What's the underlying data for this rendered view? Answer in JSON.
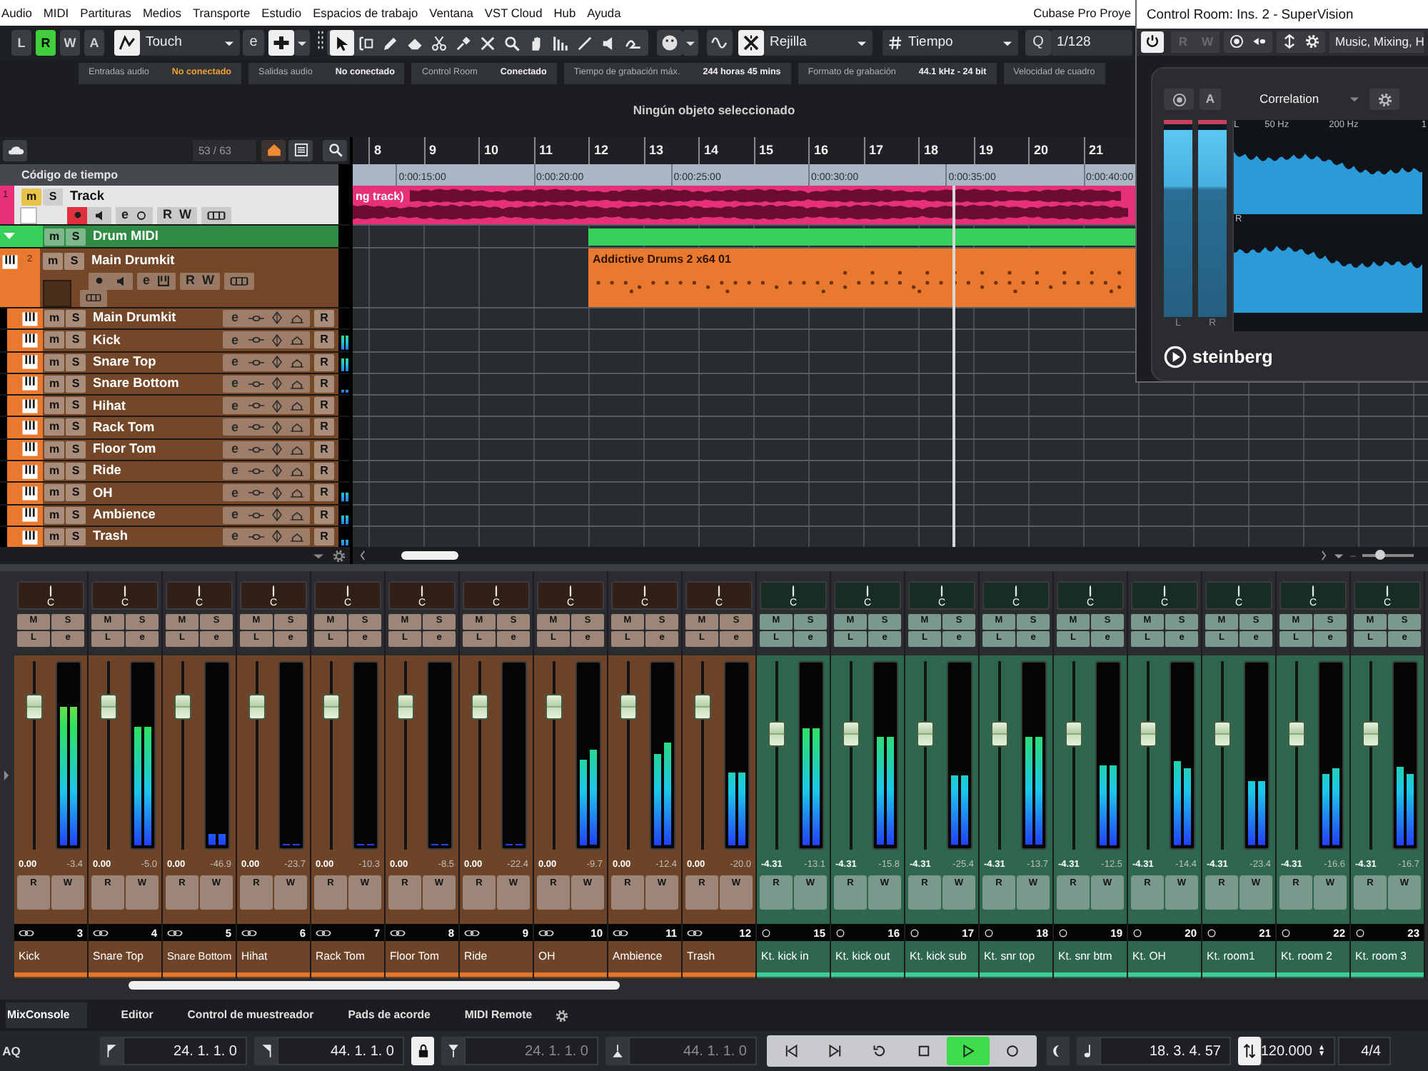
{
  "menu_bar": {
    "items": [
      "Audio",
      "MIDI",
      "Partituras",
      "Medios",
      "Transporte",
      "Estudio",
      "Espacios de trabajo",
      "Ventana",
      "VST Cloud",
      "Hub",
      "Ayuda"
    ],
    "app_title": "Cubase Pro Proye"
  },
  "toolbar": {
    "automation": [
      {
        "label": "L",
        "selected": false
      },
      {
        "label": "R",
        "selected": true
      },
      {
        "label": "W",
        "selected": false
      },
      {
        "label": "A",
        "selected": false
      }
    ],
    "automation_mode": "Touch",
    "edit_label": "e",
    "tools": [
      {
        "kind": "select",
        "selected": true
      },
      {
        "kind": "range",
        "selected": false
      },
      {
        "kind": "draw",
        "selected": false
      },
      {
        "kind": "erase",
        "selected": false
      },
      {
        "kind": "split",
        "selected": false
      },
      {
        "kind": "glue",
        "selected": false
      },
      {
        "kind": "mute",
        "selected": false
      },
      {
        "kind": "zoom",
        "selected": false
      },
      {
        "kind": "hand",
        "selected": false
      },
      {
        "kind": "comp",
        "selected": false
      },
      {
        "kind": "line",
        "selected": false
      },
      {
        "kind": "play",
        "selected": false
      },
      {
        "kind": "warp",
        "selected": false
      }
    ],
    "snap": "Rejilla",
    "grid_type": "Tiempo",
    "quantize_label": "Q",
    "quantize": "1/128"
  },
  "status_line": [
    {
      "label": "Entradas audio",
      "value": "No conectado",
      "warning": true
    },
    {
      "label": "Salidas audio",
      "value": "No conectado",
      "warning": false
    },
    {
      "label": "Control Room",
      "value": "Conectado",
      "warning": false
    },
    {
      "label": "Tiempo de grabación máx.",
      "value": "244 horas 45 mins",
      "warning": false
    },
    {
      "label": "Formato de grabación",
      "value": "44.1 kHz - 24 bit",
      "warning": false
    },
    {
      "label": "Velocidad de cuadro"
    }
  ],
  "info_line": "Ningún objeto seleccionado",
  "track_list": {
    "counter": "53 / 63",
    "ruler_track": "Código de tiempo",
    "tracks": [
      {
        "kind": "audio",
        "number": "1",
        "name": "Track",
        "color": "#e6307a",
        "selected": true,
        "muted": true,
        "armed": true,
        "buttons": [
          "m",
          "S"
        ],
        "controls": [
          "e",
          "R",
          "W"
        ]
      },
      {
        "kind": "folder",
        "name": "Drum MIDI",
        "color": "#36d05a",
        "selected": false,
        "muted": false,
        "buttons": [
          "m",
          "S"
        ]
      },
      {
        "kind": "instrument",
        "number": "2",
        "name": "Main Drumkit",
        "color": "#e8792e",
        "selected": false,
        "muted": false,
        "armed": false,
        "buttons": [
          "m",
          "S"
        ],
        "controls": [
          "e",
          "R",
          "W"
        ]
      },
      {
        "kind": "channel",
        "name": "Main Drumkit",
        "color": "#e8792e",
        "selected": false,
        "muted": false,
        "buttons": [
          "m",
          "S"
        ],
        "controls": [
          "e",
          "R"
        ]
      },
      {
        "kind": "channel",
        "name": "Kick",
        "color": "#e8792e",
        "selected": false,
        "muted": false,
        "buttons": [
          "m",
          "S"
        ],
        "controls": [
          "e",
          "R"
        ],
        "level": 0.8
      },
      {
        "kind": "channel",
        "name": "Snare Top",
        "color": "#e8792e",
        "selected": false,
        "muted": false,
        "buttons": [
          "m",
          "S"
        ],
        "controls": [
          "e",
          "R"
        ],
        "level": 0.75
      },
      {
        "kind": "channel",
        "name": "Snare Bottom",
        "color": "#e8792e",
        "selected": false,
        "muted": false,
        "buttons": [
          "m",
          "S"
        ],
        "controls": [
          "e",
          "R"
        ],
        "level": 0.15
      },
      {
        "kind": "channel",
        "name": "Hihat",
        "color": "#e8792e",
        "selected": false,
        "muted": false,
        "buttons": [
          "m",
          "S"
        ],
        "controls": [
          "e",
          "R"
        ]
      },
      {
        "kind": "channel",
        "name": "Rack Tom",
        "color": "#e8792e",
        "selected": false,
        "muted": false,
        "buttons": [
          "m",
          "S"
        ],
        "controls": [
          "e",
          "R"
        ]
      },
      {
        "kind": "channel",
        "name": "Floor Tom",
        "color": "#e8792e",
        "selected": false,
        "muted": false,
        "buttons": [
          "m",
          "S"
        ],
        "controls": [
          "e",
          "R"
        ]
      },
      {
        "kind": "channel",
        "name": "Ride",
        "color": "#e8792e",
        "selected": false,
        "muted": false,
        "buttons": [
          "m",
          "S"
        ],
        "controls": [
          "e",
          "R"
        ]
      },
      {
        "kind": "channel",
        "name": "OH",
        "color": "#e8792e",
        "selected": false,
        "muted": false,
        "buttons": [
          "m",
          "S"
        ],
        "controls": [
          "e",
          "R"
        ],
        "level": 0.5
      },
      {
        "kind": "channel",
        "name": "Ambience",
        "color": "#e8792e",
        "selected": false,
        "muted": false,
        "buttons": [
          "m",
          "S"
        ],
        "controls": [
          "e",
          "R"
        ],
        "level": 0.5
      },
      {
        "kind": "channel",
        "name": "Trash",
        "color": "#e8792e",
        "selected": false,
        "muted": false,
        "buttons": [
          "m",
          "S"
        ],
        "controls": [
          "e",
          "R"
        ],
        "level": 0.35
      }
    ]
  },
  "arrange": {
    "bars": [
      "8",
      "9",
      "10",
      "11",
      "12",
      "13",
      "14",
      "15",
      "16",
      "17",
      "18",
      "19",
      "20",
      "21"
    ],
    "timecodes": [
      "0:00:15:00",
      "0:00:20:00",
      "0:00:25:00",
      "0:00:30:00",
      "0:00:35:00",
      "0:00:40:00"
    ],
    "parts": [
      {
        "kind": "audio",
        "name": "ng track)"
      },
      {
        "kind": "folder"
      },
      {
        "kind": "midi",
        "name": "Addictive Drums 2 x64 01"
      }
    ],
    "zoom": {
      "level": 0.3
    }
  },
  "supervision": {
    "title": "Control Room: Ins. 2 - SuperVision",
    "buttons": [
      {
        "label": "R",
        "disabled": true
      },
      {
        "label": "W",
        "disabled": true
      }
    ],
    "preset": "Music, Mixing, H",
    "a_label": "A",
    "module": "Correlation",
    "meters": [
      {
        "label": "L",
        "level": 0.97
      },
      {
        "label": "R",
        "level": 0.97
      }
    ],
    "spectrum_channels": [
      "L",
      "R"
    ],
    "frequencies": [
      "50 Hz",
      "200 Hz",
      "1"
    ],
    "brand": "steinberg"
  },
  "mixer": {
    "channels": [
      {
        "name": "Kick",
        "number": "3",
        "stereo": true,
        "color": "#e4762e",
        "pan": "C",
        "buttons": [
          "M",
          "S",
          "L",
          "e"
        ],
        "volume": "0.00",
        "peak": "-3.4",
        "rw": [
          "R",
          "W"
        ],
        "fader": {
          "level": 0.8
        },
        "meter": [
          {
            "level": 0.76
          },
          {
            "level": 0.76
          }
        ]
      },
      {
        "name": "Snare Top",
        "number": "4",
        "stereo": true,
        "color": "#e4762e",
        "pan": "C",
        "buttons": [
          "M",
          "S",
          "L",
          "e"
        ],
        "volume": "0.00",
        "peak": "-5.0",
        "rw": [
          "R",
          "W"
        ],
        "fader": {
          "level": 0.8
        },
        "meter": [
          {
            "level": 0.65
          },
          {
            "level": 0.65
          }
        ]
      },
      {
        "name": "Snare Bottom",
        "number": "5",
        "stereo": true,
        "color": "#e4762e",
        "pan": "C",
        "buttons": [
          "M",
          "S",
          "L",
          "e"
        ],
        "volume": "0.00",
        "peak": "-46.9",
        "rw": [
          "R",
          "W"
        ],
        "fader": {
          "level": 0.8
        },
        "meter": [
          {
            "level": 0.06
          },
          {
            "level": 0.06
          }
        ]
      },
      {
        "name": "Hihat",
        "number": "6",
        "stereo": true,
        "color": "#e4762e",
        "pan": "C",
        "buttons": [
          "M",
          "S",
          "L",
          "e"
        ],
        "volume": "0.00",
        "peak": "-23.7",
        "rw": [
          "R",
          "W"
        ],
        "fader": {
          "level": 0.8
        },
        "meter": [
          {
            "level": 0
          },
          {
            "level": 0
          }
        ]
      },
      {
        "name": "Rack Tom",
        "number": "7",
        "stereo": true,
        "color": "#e4762e",
        "pan": "C",
        "buttons": [
          "M",
          "S",
          "L",
          "e"
        ],
        "volume": "0.00",
        "peak": "-10.3",
        "rw": [
          "R",
          "W"
        ],
        "fader": {
          "level": 0.8
        },
        "meter": [
          {
            "level": 0
          },
          {
            "level": 0
          }
        ]
      },
      {
        "name": "Floor Tom",
        "number": "8",
        "stereo": true,
        "color": "#e4762e",
        "pan": "C",
        "buttons": [
          "M",
          "S",
          "L",
          "e"
        ],
        "volume": "0.00",
        "peak": "-8.5",
        "rw": [
          "R",
          "W"
        ],
        "fader": {
          "level": 0.8
        },
        "meter": [
          {
            "level": 0
          },
          {
            "level": 0
          }
        ]
      },
      {
        "name": "Ride",
        "number": "9",
        "stereo": true,
        "color": "#e4762e",
        "pan": "C",
        "buttons": [
          "M",
          "S",
          "L",
          "e"
        ],
        "volume": "0.00",
        "peak": "-22.4",
        "rw": [
          "R",
          "W"
        ],
        "fader": {
          "level": 0.8
        },
        "meter": [
          {
            "level": 0
          },
          {
            "level": 0
          }
        ]
      },
      {
        "name": "OH",
        "number": "10",
        "stereo": true,
        "color": "#e4762e",
        "pan": "C",
        "buttons": [
          "M",
          "S",
          "L",
          "e"
        ],
        "volume": "0.00",
        "peak": "-9.7",
        "rw": [
          "R",
          "W"
        ],
        "fader": {
          "level": 0.8
        },
        "meter": [
          {
            "level": 0.47
          },
          {
            "level": 0.52
          }
        ]
      },
      {
        "name": "Ambience",
        "number": "11",
        "stereo": true,
        "color": "#e4762e",
        "pan": "C",
        "buttons": [
          "M",
          "S",
          "L",
          "e"
        ],
        "volume": "0.00",
        "peak": "-12.4",
        "rw": [
          "R",
          "W"
        ],
        "fader": {
          "level": 0.8
        },
        "meter": [
          {
            "level": 0.5
          },
          {
            "level": 0.56
          }
        ]
      },
      {
        "name": "Trash",
        "number": "12",
        "stereo": true,
        "color": "#e4762e",
        "pan": "C",
        "buttons": [
          "M",
          "S",
          "L",
          "e"
        ],
        "volume": "0.00",
        "peak": "-20.0",
        "rw": [
          "R",
          "W"
        ],
        "fader": {
          "level": 0.8
        },
        "meter": [
          {
            "level": 0.4
          },
          {
            "level": 0.4
          }
        ]
      },
      {
        "name": "Kt. kick in",
        "number": "15",
        "stereo": false,
        "color": "#3ccf95",
        "pan": "C",
        "buttons": [
          "M",
          "S",
          "L",
          "e"
        ],
        "volume": "-4.31",
        "peak": "-13.1",
        "rw": [
          "R",
          "W"
        ],
        "fader": {
          "level": 0.63
        },
        "meter": [
          {
            "level": 0.64
          },
          {
            "level": 0.64
          }
        ]
      },
      {
        "name": "Kt. kick out",
        "number": "16",
        "stereo": false,
        "color": "#3ccf95",
        "pan": "C",
        "buttons": [
          "M",
          "S",
          "L",
          "e"
        ],
        "volume": "-4.31",
        "peak": "-15.8",
        "rw": [
          "R",
          "W"
        ],
        "fader": {
          "level": 0.63
        },
        "meter": [
          {
            "level": 0.59
          },
          {
            "level": 0.59
          }
        ]
      },
      {
        "name": "Kt. kick sub",
        "number": "17",
        "stereo": false,
        "color": "#3ccf95",
        "pan": "C",
        "buttons": [
          "M",
          "S",
          "L",
          "e"
        ],
        "volume": "-4.31",
        "peak": "-25.4",
        "rw": [
          "R",
          "W"
        ],
        "fader": {
          "level": 0.63
        },
        "meter": [
          {
            "level": 0.38
          },
          {
            "level": 0.38
          }
        ]
      },
      {
        "name": "Kt. snr top",
        "number": "18",
        "stereo": false,
        "color": "#3ccf95",
        "pan": "C",
        "buttons": [
          "M",
          "S",
          "L",
          "e"
        ],
        "volume": "-4.31",
        "peak": "-13.7",
        "rw": [
          "R",
          "W"
        ],
        "fader": {
          "level": 0.63
        },
        "meter": [
          {
            "level": 0.59
          },
          {
            "level": 0.59
          }
        ]
      },
      {
        "name": "Kt. snr btm",
        "number": "19",
        "stereo": false,
        "color": "#3ccf95",
        "pan": "C",
        "buttons": [
          "M",
          "S",
          "L",
          "e"
        ],
        "volume": "-4.31",
        "peak": "-12.5",
        "rw": [
          "R",
          "W"
        ],
        "fader": {
          "level": 0.63
        },
        "meter": [
          {
            "level": 0.44
          },
          {
            "level": 0.44
          }
        ]
      },
      {
        "name": "Kt. OH",
        "number": "20",
        "stereo": false,
        "color": "#3ccf95",
        "pan": "C",
        "buttons": [
          "M",
          "S",
          "L",
          "e"
        ],
        "volume": "-4.31",
        "peak": "-14.4",
        "rw": [
          "R",
          "W"
        ],
        "fader": {
          "level": 0.63
        },
        "meter": [
          {
            "level": 0.46
          },
          {
            "level": 0.42
          }
        ]
      },
      {
        "name": "Kt. room1",
        "number": "21",
        "stereo": false,
        "color": "#3ccf95",
        "pan": "C",
        "buttons": [
          "M",
          "S",
          "L",
          "e"
        ],
        "volume": "-4.31",
        "peak": "-23.4",
        "rw": [
          "R",
          "W"
        ],
        "fader": {
          "level": 0.63
        },
        "meter": [
          {
            "level": 0.35
          },
          {
            "level": 0.35
          }
        ]
      },
      {
        "name": "Kt. room 2",
        "number": "22",
        "stereo": false,
        "color": "#3ccf95",
        "pan": "C",
        "buttons": [
          "M",
          "S",
          "L",
          "e"
        ],
        "volume": "-4.31",
        "peak": "-16.6",
        "rw": [
          "R",
          "W"
        ],
        "fader": {
          "level": 0.63
        },
        "meter": [
          {
            "level": 0.39
          },
          {
            "level": 0.42
          }
        ]
      },
      {
        "name": "Kt. room 3",
        "number": "23",
        "stereo": false,
        "color": "#3ccf95",
        "pan": "C",
        "buttons": [
          "M",
          "S",
          "L",
          "e"
        ],
        "volume": "-4.31",
        "peak": "-16.7",
        "rw": [
          "R",
          "W"
        ],
        "fader": {
          "level": 0.63
        },
        "meter": [
          {
            "level": 0.43
          },
          {
            "level": 0.39
          }
        ]
      }
    ]
  },
  "bottom_tabs": [
    {
      "label": "MixConsole",
      "selected": true
    },
    {
      "label": "Editor",
      "selected": false
    },
    {
      "label": "Control de muestreador",
      "selected": false
    },
    {
      "label": "Pads de acorde",
      "selected": false
    },
    {
      "label": "MIDI Remote",
      "selected": false
    }
  ],
  "transport": {
    "aq_label": "AQ",
    "left_locator": "24. 1. 1. 0",
    "right_locator": "44. 1. 1. 0",
    "lock_on": true,
    "punch_in": {
      "value": "24. 1. 1. 0",
      "disabled": true
    },
    "punch_out": {
      "value": "44. 1. 1. 0",
      "disabled": true
    },
    "controls": [
      {
        "kind": "prev",
        "selected": false
      },
      {
        "kind": "next",
        "selected": false
      },
      {
        "kind": "cycle",
        "selected": false
      },
      {
        "kind": "stop",
        "selected": false
      },
      {
        "kind": "play",
        "selected": true
      },
      {
        "kind": "record",
        "selected": false
      }
    ],
    "position": "18. 3. 4. 57",
    "tempo_on": true,
    "tempo": "120.000",
    "signature": "4/4"
  }
}
